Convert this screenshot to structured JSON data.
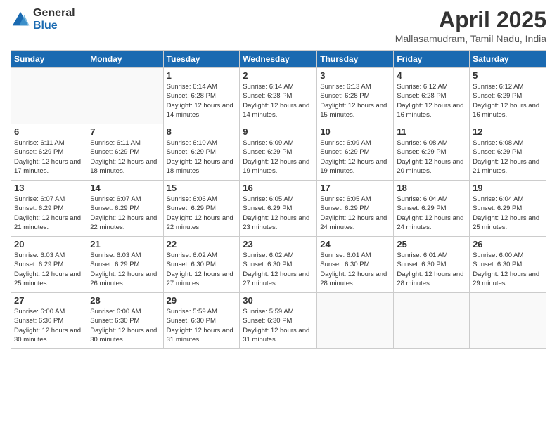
{
  "logo": {
    "general": "General",
    "blue": "Blue"
  },
  "title": {
    "month": "April 2025",
    "location": "Mallasamudram, Tamil Nadu, India"
  },
  "days_of_week": [
    "Sunday",
    "Monday",
    "Tuesday",
    "Wednesday",
    "Thursday",
    "Friday",
    "Saturday"
  ],
  "weeks": [
    [
      {
        "day": "",
        "info": ""
      },
      {
        "day": "",
        "info": ""
      },
      {
        "day": "1",
        "info": "Sunrise: 6:14 AM\nSunset: 6:28 PM\nDaylight: 12 hours and 14 minutes."
      },
      {
        "day": "2",
        "info": "Sunrise: 6:14 AM\nSunset: 6:28 PM\nDaylight: 12 hours and 14 minutes."
      },
      {
        "day": "3",
        "info": "Sunrise: 6:13 AM\nSunset: 6:28 PM\nDaylight: 12 hours and 15 minutes."
      },
      {
        "day": "4",
        "info": "Sunrise: 6:12 AM\nSunset: 6:28 PM\nDaylight: 12 hours and 16 minutes."
      },
      {
        "day": "5",
        "info": "Sunrise: 6:12 AM\nSunset: 6:29 PM\nDaylight: 12 hours and 16 minutes."
      }
    ],
    [
      {
        "day": "6",
        "info": "Sunrise: 6:11 AM\nSunset: 6:29 PM\nDaylight: 12 hours and 17 minutes."
      },
      {
        "day": "7",
        "info": "Sunrise: 6:11 AM\nSunset: 6:29 PM\nDaylight: 12 hours and 18 minutes."
      },
      {
        "day": "8",
        "info": "Sunrise: 6:10 AM\nSunset: 6:29 PM\nDaylight: 12 hours and 18 minutes."
      },
      {
        "day": "9",
        "info": "Sunrise: 6:09 AM\nSunset: 6:29 PM\nDaylight: 12 hours and 19 minutes."
      },
      {
        "day": "10",
        "info": "Sunrise: 6:09 AM\nSunset: 6:29 PM\nDaylight: 12 hours and 19 minutes."
      },
      {
        "day": "11",
        "info": "Sunrise: 6:08 AM\nSunset: 6:29 PM\nDaylight: 12 hours and 20 minutes."
      },
      {
        "day": "12",
        "info": "Sunrise: 6:08 AM\nSunset: 6:29 PM\nDaylight: 12 hours and 21 minutes."
      }
    ],
    [
      {
        "day": "13",
        "info": "Sunrise: 6:07 AM\nSunset: 6:29 PM\nDaylight: 12 hours and 21 minutes."
      },
      {
        "day": "14",
        "info": "Sunrise: 6:07 AM\nSunset: 6:29 PM\nDaylight: 12 hours and 22 minutes."
      },
      {
        "day": "15",
        "info": "Sunrise: 6:06 AM\nSunset: 6:29 PM\nDaylight: 12 hours and 22 minutes."
      },
      {
        "day": "16",
        "info": "Sunrise: 6:05 AM\nSunset: 6:29 PM\nDaylight: 12 hours and 23 minutes."
      },
      {
        "day": "17",
        "info": "Sunrise: 6:05 AM\nSunset: 6:29 PM\nDaylight: 12 hours and 24 minutes."
      },
      {
        "day": "18",
        "info": "Sunrise: 6:04 AM\nSunset: 6:29 PM\nDaylight: 12 hours and 24 minutes."
      },
      {
        "day": "19",
        "info": "Sunrise: 6:04 AM\nSunset: 6:29 PM\nDaylight: 12 hours and 25 minutes."
      }
    ],
    [
      {
        "day": "20",
        "info": "Sunrise: 6:03 AM\nSunset: 6:29 PM\nDaylight: 12 hours and 25 minutes."
      },
      {
        "day": "21",
        "info": "Sunrise: 6:03 AM\nSunset: 6:29 PM\nDaylight: 12 hours and 26 minutes."
      },
      {
        "day": "22",
        "info": "Sunrise: 6:02 AM\nSunset: 6:30 PM\nDaylight: 12 hours and 27 minutes."
      },
      {
        "day": "23",
        "info": "Sunrise: 6:02 AM\nSunset: 6:30 PM\nDaylight: 12 hours and 27 minutes."
      },
      {
        "day": "24",
        "info": "Sunrise: 6:01 AM\nSunset: 6:30 PM\nDaylight: 12 hours and 28 minutes."
      },
      {
        "day": "25",
        "info": "Sunrise: 6:01 AM\nSunset: 6:30 PM\nDaylight: 12 hours and 28 minutes."
      },
      {
        "day": "26",
        "info": "Sunrise: 6:00 AM\nSunset: 6:30 PM\nDaylight: 12 hours and 29 minutes."
      }
    ],
    [
      {
        "day": "27",
        "info": "Sunrise: 6:00 AM\nSunset: 6:30 PM\nDaylight: 12 hours and 30 minutes."
      },
      {
        "day": "28",
        "info": "Sunrise: 6:00 AM\nSunset: 6:30 PM\nDaylight: 12 hours and 30 minutes."
      },
      {
        "day": "29",
        "info": "Sunrise: 5:59 AM\nSunset: 6:30 PM\nDaylight: 12 hours and 31 minutes."
      },
      {
        "day": "30",
        "info": "Sunrise: 5:59 AM\nSunset: 6:30 PM\nDaylight: 12 hours and 31 minutes."
      },
      {
        "day": "",
        "info": ""
      },
      {
        "day": "",
        "info": ""
      },
      {
        "day": "",
        "info": ""
      }
    ]
  ]
}
